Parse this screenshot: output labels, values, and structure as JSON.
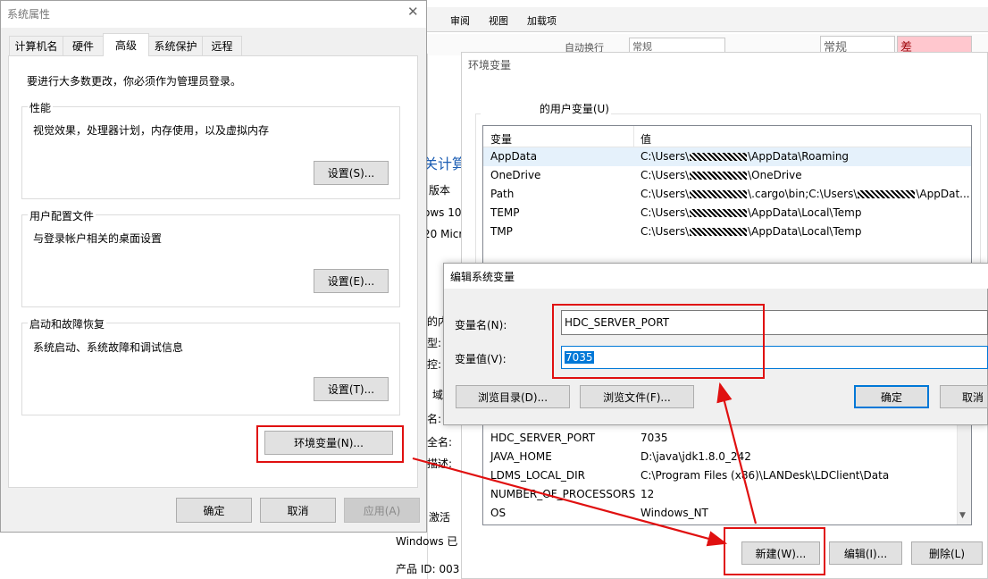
{
  "bg_window": {
    "ribbon_tabs": [
      "审阅",
      "视图",
      "加载项"
    ],
    "ribbon_items": [
      "自动换行",
      "常规",
      "常规",
      "差"
    ],
    "fragments": [
      "关计算",
      "版本",
      "ows 10",
      "20 Micr",
      "的内",
      "型:",
      "控:",
      "域",
      "名:",
      "全名:",
      "描述:",
      "激活",
      "Windows 已",
      "产品 ID: 003"
    ]
  },
  "sys_props": {
    "title": "系统属性",
    "tabs": [
      "计算机名",
      "硬件",
      "高级",
      "系统保护",
      "远程"
    ],
    "admin_note": "要进行大多数更改，你必须作为管理员登录。",
    "perf_title": "性能",
    "perf_desc": "视觉效果，处理器计划，内存使用，以及虚拟内存",
    "perf_btn": "设置(S)...",
    "profile_title": "用户配置文件",
    "profile_desc": "与登录帐户相关的桌面设置",
    "profile_btn": "设置(E)...",
    "startup_title": "启动和故障恢复",
    "startup_desc": "系统启动、系统故障和调试信息",
    "startup_btn": "设置(T)...",
    "env_btn": "环境变量(N)...",
    "ok": "确定",
    "cancel": "取消",
    "apply": "应用(A)"
  },
  "env_vars": {
    "title": "环境变量",
    "user_group_suffix": "的用户变量(U)",
    "col_var": "变量",
    "col_val": "值",
    "user_rows": [
      {
        "name": "AppData",
        "pre": "C:\\Users\\",
        "post": "\\AppData\\Roaming"
      },
      {
        "name": "OneDrive",
        "pre": "C:\\Users\\",
        "post": "\\OneDrive"
      },
      {
        "name": "Path",
        "pre": "C:\\Users\\",
        "post": "\\.cargo\\bin;C:\\Users\\",
        "post2": "\\AppDat..."
      },
      {
        "name": "TEMP",
        "pre": "C:\\Users\\",
        "post": "\\AppData\\Local\\Temp"
      },
      {
        "name": "TMP",
        "pre": "C:\\Users\\",
        "post": "\\AppData\\Local\\Temp"
      }
    ],
    "sys_rows": [
      {
        "name": "HDC_SERVER_PORT",
        "value": "7035"
      },
      {
        "name": "JAVA_HOME",
        "value": "D:\\java\\jdk1.8.0_242"
      },
      {
        "name": "LDMS_LOCAL_DIR",
        "value": "C:\\Program Files (x86)\\LANDesk\\LDClient\\Data"
      },
      {
        "name": "NUMBER_OF_PROCESSORS",
        "value": "12"
      },
      {
        "name": "OS",
        "value": "Windows_NT"
      }
    ],
    "new_btn": "新建(W)...",
    "edit_btn": "编辑(I)...",
    "delete_btn": "删除(L)"
  },
  "edit_dialog": {
    "title": "编辑系统变量",
    "name_label": "变量名(N):",
    "value_label": "变量值(V):",
    "name_value": "HDC_SERVER_PORT",
    "value_value": "7035",
    "browse_dir": "浏览目录(D)...",
    "browse_file": "浏览文件(F)...",
    "ok": "确定",
    "cancel": "取消"
  },
  "colors": {
    "annotation_red": "#e01010",
    "selection_blue": "#0078d7",
    "button_gray": "#e1e1e1"
  }
}
